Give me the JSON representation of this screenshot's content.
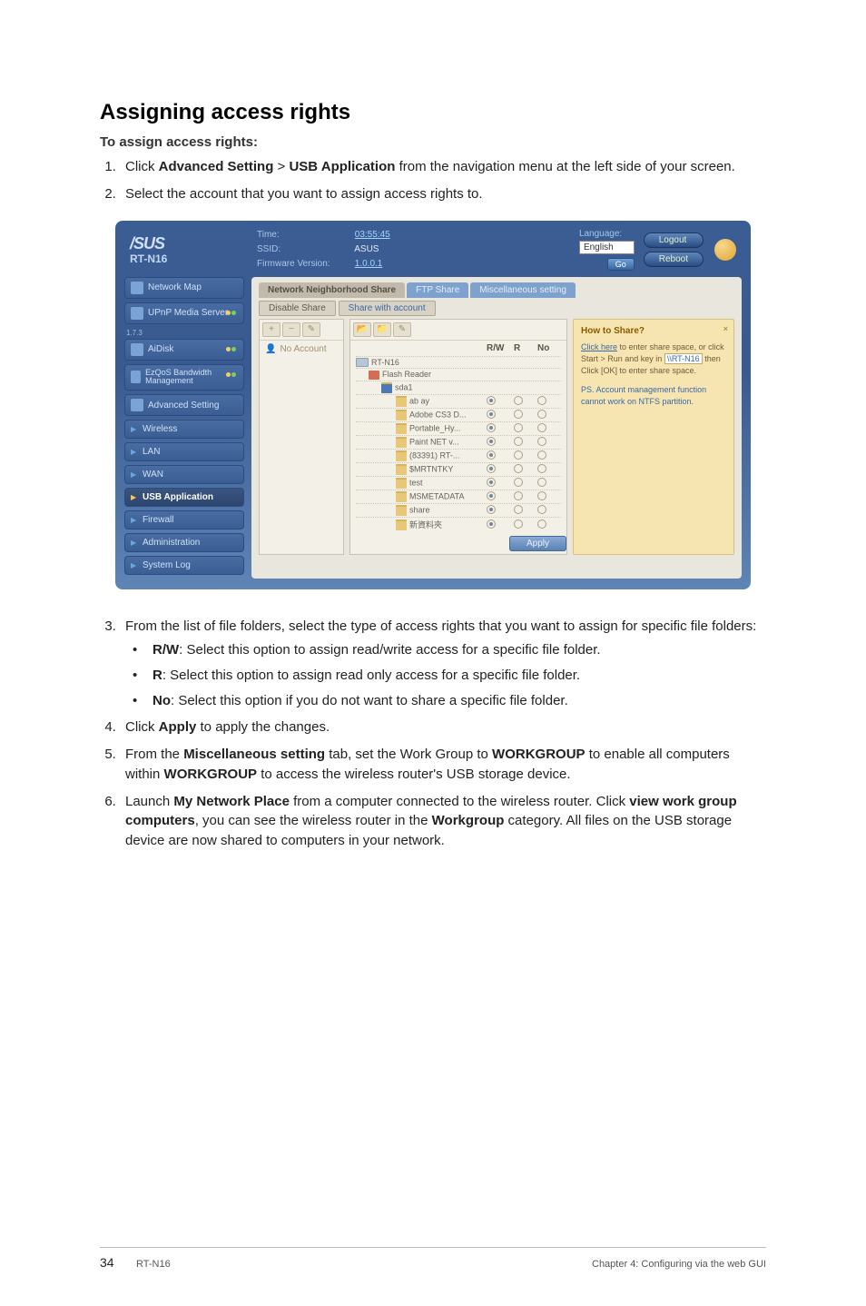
{
  "heading": "Assigning access rights",
  "subheading": "To assign access rights:",
  "steps_top": [
    {
      "pre": "Click ",
      "b1": "Advanced Setting",
      "mid": " > ",
      "b2": "USB Application",
      "post": " from the navigation menu at the left side of your screen."
    },
    {
      "pre": "Select the account that you want to assign access rights to.",
      "b1": "",
      "mid": "",
      "b2": "",
      "post": ""
    }
  ],
  "shot": {
    "logo": "/SUS",
    "model": "RT-N16",
    "header": {
      "time_lbl": "Time:",
      "time_val": "03:55:45",
      "ssid_lbl": "SSID:",
      "ssid_val": "ASUS",
      "fw_lbl": "Firmware Version:",
      "fw_val": "1.0.0.1",
      "lang_lbl": "Language:",
      "lang_val": "English",
      "go": "Go",
      "logout": "Logout",
      "reboot": "Reboot"
    },
    "sidebar": {
      "items": [
        {
          "label": "Network Map",
          "status": ""
        },
        {
          "label": "UPnP Media Server",
          "status": "yg"
        },
        {
          "header": "1.7.3"
        },
        {
          "label": "AiDisk",
          "status": "yg"
        },
        {
          "label": "EzQoS Bandwidth Management",
          "status": "yg",
          "twoLine": true
        },
        {
          "label": "Advanced Setting",
          "status": ""
        },
        {
          "sub": true,
          "arrow": "blue",
          "label": "Wireless"
        },
        {
          "sub": true,
          "arrow": "blue",
          "label": "LAN"
        },
        {
          "sub": true,
          "arrow": "blue",
          "label": "WAN"
        },
        {
          "sub": true,
          "arrow": "gold",
          "label": "USB Application",
          "sel": true
        },
        {
          "sub": true,
          "arrow": "blue",
          "label": "Firewall"
        },
        {
          "sub": true,
          "arrow": "blue",
          "label": "Administration"
        },
        {
          "sub": true,
          "arrow": "blue",
          "label": "System Log"
        }
      ]
    },
    "tabs": [
      "Network Neighborhood Share",
      "FTP Share",
      "Miscellaneous setting"
    ],
    "filters": [
      "Disable Share",
      "Share with account"
    ],
    "account": "No Account",
    "tree_head": {
      "name": "",
      "rw": "R/W",
      "r": "R",
      "no": "No"
    },
    "tree": [
      {
        "indent": 0,
        "icon": "disk",
        "label": "RT-N16"
      },
      {
        "indent": 1,
        "icon": "drive",
        "label": "Flash Reader"
      },
      {
        "indent": 2,
        "icon": "sel",
        "label": "sda1"
      },
      {
        "indent": 3,
        "icon": "",
        "label": "ab ay",
        "rw": true
      },
      {
        "indent": 3,
        "icon": "",
        "label": "Adobe CS3 D...",
        "rw": true
      },
      {
        "indent": 3,
        "icon": "",
        "label": "Portable_Hy...",
        "rw": true
      },
      {
        "indent": 3,
        "icon": "",
        "label": "Paint NET v...",
        "rw": true
      },
      {
        "indent": 3,
        "icon": "",
        "label": "(83391) RT-...",
        "rw": true
      },
      {
        "indent": 3,
        "icon": "",
        "label": "$MRTNTKY",
        "rw": true
      },
      {
        "indent": 3,
        "icon": "",
        "label": "test",
        "rw": true
      },
      {
        "indent": 3,
        "icon": "",
        "label": "MSMETADATA",
        "rw": true
      },
      {
        "indent": 3,
        "icon": "",
        "label": "share",
        "rw": true
      },
      {
        "indent": 3,
        "icon": "",
        "label": "新資料夾",
        "rw": true
      }
    ],
    "apply": "Apply",
    "help": {
      "title": "How to Share?",
      "line1a": "Click here",
      "line1b": " to enter share space, or click Start > Run and key in",
      "input": "\\\\RT-N16",
      "line2": " then Click [OK] to enter share space.",
      "ps": "PS. Account management function cannot work on NTFS partition."
    }
  },
  "steps_bottom": {
    "s3_intro": "From the list of file folders, select the type of access rights that you want to assign for specific file folders:",
    "bullets": [
      {
        "b": "R/W",
        "txt": ": Select this option to assign read/write access for a specific file folder."
      },
      {
        "b": "R",
        "txt": ": Select this option to assign read only access for a specific file folder."
      },
      {
        "b": "No",
        "txt": ": Select this option if you do not want to share a specific file folder."
      }
    ],
    "s4_pre": "Click ",
    "s4_b": "Apply",
    "s4_post": " to apply the changes.",
    "s5_pre": "From the ",
    "s5_b1": "Miscellaneous setting",
    "s5_mid": " tab, set the Work Group to ",
    "s5_b2": "WORKGROUP",
    "s5_mid2": " to enable all computers within ",
    "s5_b3": "WORKGROUP",
    "s5_post": " to access the wireless router's USB storage device.",
    "s6_pre": "Launch ",
    "s6_b1": "My Network Place",
    "s6_mid": " from a computer connected to the wireless router. Click ",
    "s6_b2": "view work group computers",
    "s6_mid2": ", you can see the wireless router in the ",
    "s6_b3": "Workgroup",
    "s6_post": " category. All files on the USB storage device are now shared to computers in your network."
  },
  "footer": {
    "page": "34",
    "model": "RT-N16",
    "chapter": "Chapter 4: Configuring via the web GUI"
  }
}
